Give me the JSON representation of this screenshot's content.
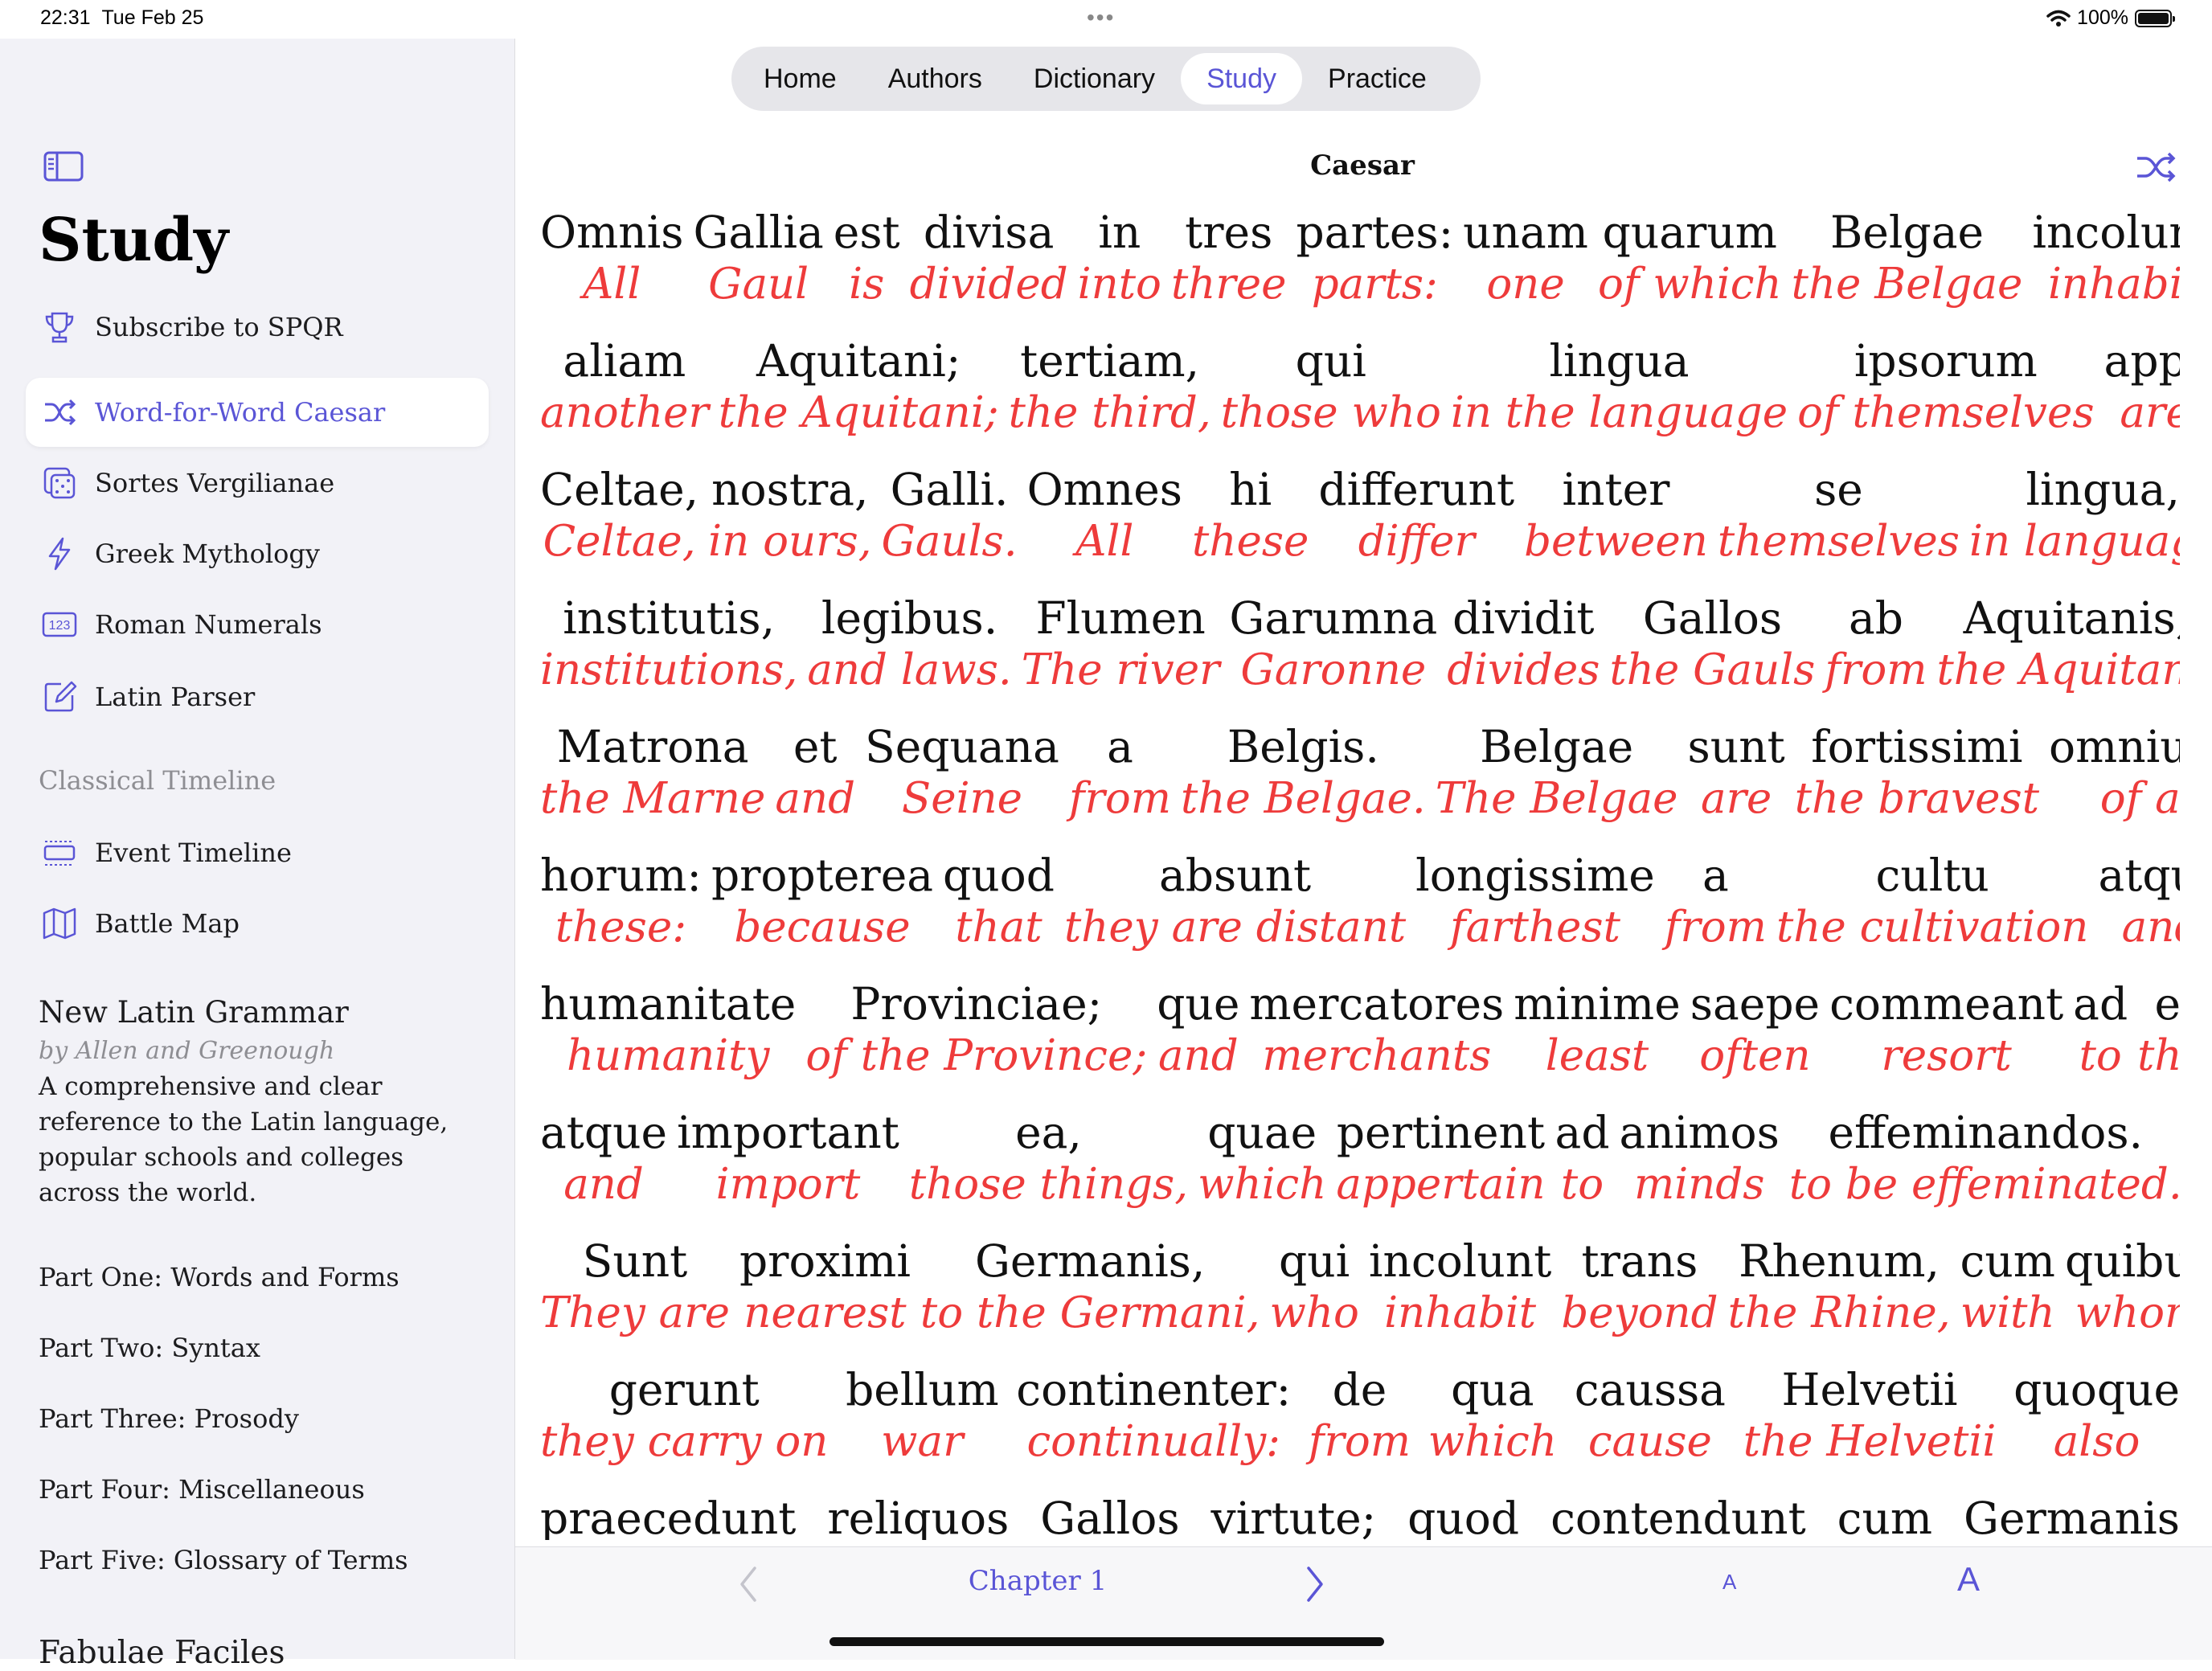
{
  "status_bar": {
    "time": "22:31",
    "date": "Tue Feb 25",
    "battery": "100%"
  },
  "sidebar": {
    "title": "Study",
    "items": [
      {
        "label": "Subscribe to SPQR",
        "icon": "trophy-icon"
      },
      {
        "label": "Word-for-Word Caesar",
        "icon": "shuffle-icon",
        "selected": true
      },
      {
        "label": "Sortes Vergilianae",
        "icon": "dice-icon"
      },
      {
        "label": "Greek Mythology",
        "icon": "bolt-icon"
      },
      {
        "label": "Roman Numerals",
        "icon": "numbers-icon"
      },
      {
        "label": "Latin Parser",
        "icon": "edit-icon"
      }
    ],
    "timeline_section": "Classical Timeline",
    "timeline_items": [
      {
        "label": "Event Timeline",
        "icon": "timeline-icon"
      },
      {
        "label": "Battle Map",
        "icon": "map-icon"
      }
    ],
    "grammar": {
      "title": "New Latin Grammar",
      "author": "by Allen and Greenough",
      "description": "A comprehensive and clear reference to the Latin language, popular schools and colleges across the world."
    },
    "parts": [
      "Part One: Words and Forms",
      "Part Two: Syntax",
      "Part Three: Prosody",
      "Part Four: Miscellaneous",
      "Part Five: Glossary of Terms"
    ],
    "next_section": "Fabulae Faciles"
  },
  "nav": {
    "tabs": [
      "Home",
      "Authors",
      "Dictionary",
      "Study",
      "Practice"
    ],
    "active": "Study"
  },
  "reader": {
    "title": "Caesar",
    "lines": [
      [
        [
          "Omnis",
          "All"
        ],
        [
          "Gallia",
          "Gaul"
        ],
        [
          "est",
          "is"
        ],
        [
          "divisa",
          "divided"
        ],
        [
          "in",
          "into"
        ],
        [
          "tres",
          "three"
        ],
        [
          "partes:",
          "parts:"
        ],
        [
          "unam",
          "one"
        ],
        [
          "quarum",
          "of which"
        ],
        [
          "Belgae",
          "the Belgae"
        ],
        [
          "incolunt;",
          "inhabit;"
        ]
      ],
      [
        [
          "aliam",
          "another"
        ],
        [
          "Aquitani;",
          "the Aquitani;"
        ],
        [
          "tertiam,",
          "the third,"
        ],
        [
          "qui",
          "those who"
        ],
        [
          "lingua",
          "in the language"
        ],
        [
          "ipsorum",
          "of themselves"
        ],
        [
          "appelantur",
          "are called"
        ]
      ],
      [
        [
          "Celtae,",
          "Celtae,"
        ],
        [
          "nostra,",
          "in ours,"
        ],
        [
          "Galli.",
          "Gauls."
        ],
        [
          "Omnes",
          "All"
        ],
        [
          "hi",
          "these"
        ],
        [
          "differunt",
          "differ"
        ],
        [
          "inter",
          "between"
        ],
        [
          "se",
          "themselves"
        ],
        [
          "lingua,",
          "in language,"
        ]
      ],
      [
        [
          "institutis,",
          "institutions,"
        ],
        [
          "legibus.",
          "and laws."
        ],
        [
          "Flumen",
          "The river"
        ],
        [
          "Garumna",
          "Garonne"
        ],
        [
          "dividit",
          "divides"
        ],
        [
          "Gallos",
          "the Gauls"
        ],
        [
          "ab",
          "from"
        ],
        [
          "Aquitanis,",
          "the Aquitani,"
        ]
      ],
      [
        [
          "Matrona",
          "the Marne"
        ],
        [
          "et",
          "and"
        ],
        [
          "Sequana",
          "Seine"
        ],
        [
          "a",
          "from"
        ],
        [
          "Belgis.",
          "the Belgae."
        ],
        [
          "Belgae",
          "The Belgae"
        ],
        [
          "sunt",
          "are"
        ],
        [
          "fortissimi",
          "the bravest"
        ],
        [
          "omniuum",
          "of all"
        ]
      ],
      [
        [
          "horum:",
          "these:"
        ],
        [
          "propterea",
          "because"
        ],
        [
          "quod",
          "that"
        ],
        [
          "absunt",
          "they are distant"
        ],
        [
          "longissime",
          "farthest"
        ],
        [
          "a",
          "from"
        ],
        [
          "cultu",
          "the cultivation"
        ],
        [
          "atque",
          "and"
        ]
      ],
      [
        [
          "humanitate",
          "humanity"
        ],
        [
          "Provinciae;",
          "of the Province;"
        ],
        [
          "que",
          "and"
        ],
        [
          "mercatores",
          "merchants"
        ],
        [
          "minime",
          "least"
        ],
        [
          "saepe",
          "often"
        ],
        [
          "commeant",
          "resort"
        ],
        [
          "ad",
          "to"
        ],
        [
          "eos,",
          "them,"
        ]
      ],
      [
        [
          "atque",
          "and"
        ],
        [
          "important",
          "import"
        ],
        [
          "ea,",
          "those things,"
        ],
        [
          "quae",
          "which"
        ],
        [
          "pertinent",
          "appertain"
        ],
        [
          "ad",
          "to"
        ],
        [
          "animos",
          "minds"
        ],
        [
          "effeminandos.",
          "to be effeminated."
        ]
      ],
      [
        [
          "Sunt",
          "They are"
        ],
        [
          "proximi",
          "nearest"
        ],
        [
          "Germanis,",
          "to the Germani,"
        ],
        [
          "qui",
          "who"
        ],
        [
          "incolunt",
          "inhabit"
        ],
        [
          "trans",
          "beyond"
        ],
        [
          "Rhenum,",
          "the Rhine,"
        ],
        [
          "cum",
          "with"
        ],
        [
          "quibus",
          "whom"
        ]
      ],
      [
        [
          "gerunt",
          "they carry on"
        ],
        [
          "bellum",
          "war"
        ],
        [
          "continenter:",
          "continually:"
        ],
        [
          "de",
          "from"
        ],
        [
          "qua",
          "which"
        ],
        [
          "caussa",
          "cause"
        ],
        [
          "Helvetii",
          "the Helvetii"
        ],
        [
          "quoque",
          "also"
        ]
      ],
      [
        [
          "praecedunt",
          ""
        ],
        [
          "reliquos",
          ""
        ],
        [
          "Gallos",
          ""
        ],
        [
          "virtute;",
          ""
        ],
        [
          "quod",
          ""
        ],
        [
          "contendunt",
          ""
        ],
        [
          "cum",
          ""
        ],
        [
          "Germanis",
          ""
        ]
      ]
    ]
  },
  "toolbar": {
    "chapter": "Chapter 1",
    "font_small": "A",
    "font_large": "A"
  },
  "colors": {
    "accent": "#5a55d6",
    "translation": "#ee3b3b",
    "sidebar_bg": "#f2f2f7"
  }
}
